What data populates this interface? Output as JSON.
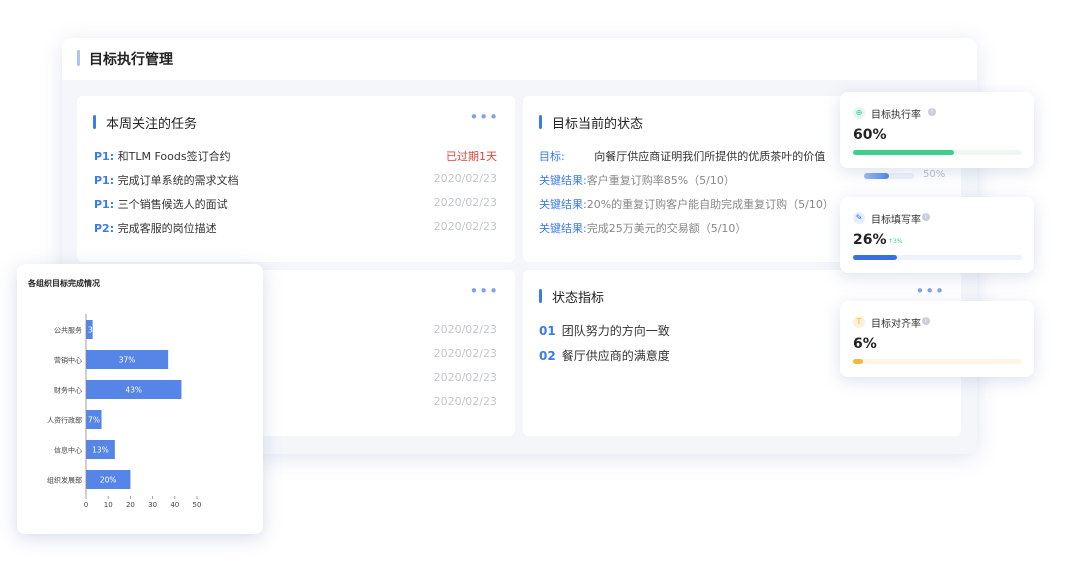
{
  "main": {
    "title": "目标执行管理"
  },
  "tasks": {
    "title": "本周关注的任务",
    "more": "•••",
    "items": [
      {
        "priority": "P1:",
        "text": "和TLM Foods签订合约",
        "date": "已过期1天",
        "overdue": true
      },
      {
        "priority": "P1:",
        "text": "完成订单系统的需求文档",
        "date": "2020/02/23",
        "overdue": false
      },
      {
        "priority": "P1:",
        "text": "三个销售候选人的面试",
        "date": "2020/02/23",
        "overdue": false
      },
      {
        "priority": "P2:",
        "text": "完成客服的岗位描述",
        "date": "2020/02/23",
        "overdue": false
      }
    ]
  },
  "status": {
    "title": "目标当前的状态",
    "more": "•••",
    "goal_label": "目标:",
    "goal_text": "向餐厅供应商证明我们所提供的优质茶叶的价值",
    "results": [
      {
        "label": "关键结果:",
        "text": "客户重复订购率85%（5/10）"
      },
      {
        "label": "关键结果:",
        "text": "20%的重复订购客户能自助完成重复订购（5/10）"
      },
      {
        "label": "关键结果:",
        "text": "完成25万美元的交易额（5/10）"
      }
    ],
    "progress_value": 0.5,
    "progress_label": "50%"
  },
  "lower_left": {
    "more": "•••",
    "dates": [
      "2020/02/23",
      "2020/02/23",
      "2020/02/23",
      "2020/02/23"
    ]
  },
  "indicators": {
    "title": "状态指标",
    "more": "•••",
    "items": [
      {
        "num": "01",
        "text": "团队努力的方向一致"
      },
      {
        "num": "02",
        "text": "餐厅供应商的满意度"
      }
    ]
  },
  "kpis": [
    {
      "label": "目标执行率",
      "value": "60%",
      "fraction": 0.6,
      "icon": "org-icon",
      "icon_glyph": "⊕",
      "color": "#3ecf8e",
      "track": "#eef8f3",
      "icon_bg": "#e3f7ee",
      "trend": ""
    },
    {
      "label": "目标填写率",
      "value": "26%",
      "fraction": 0.26,
      "icon": "edit-icon",
      "icon_glyph": "✎",
      "color": "#3a6fe0",
      "track": "#eef2fb",
      "icon_bg": "#e6eefc",
      "trend": "↑3%"
    },
    {
      "label": "目标对齐率",
      "value": "6%",
      "fraction": 0.06,
      "icon": "align-icon",
      "icon_glyph": "T",
      "color": "#f0b93a",
      "track": "#fdf6e6",
      "icon_bg": "#fdf1d9",
      "trend": ""
    }
  ],
  "chart_data": {
    "type": "bar",
    "orientation": "horizontal",
    "title": "各组织目标完成情况",
    "categories": [
      "公共服务",
      "营销中心",
      "财务中心",
      "人资行政部",
      "信息中心",
      "组织发展部"
    ],
    "values": [
      3,
      37,
      43,
      7,
      13,
      20
    ],
    "labels": [
      "3%",
      "37%",
      "43%",
      "7%",
      "13%",
      "20%"
    ],
    "xlim": [
      0,
      50
    ],
    "xticks": [
      "0",
      "10",
      "20",
      "30",
      "40",
      "50"
    ],
    "color": "#5585e6"
  }
}
